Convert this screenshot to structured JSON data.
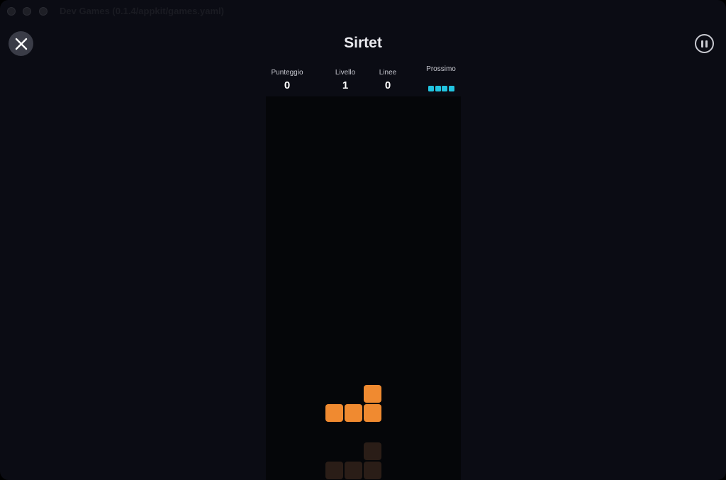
{
  "window": {
    "title": "Dev Games (0.1.4/appkit/games.yaml)"
  },
  "header": {
    "title": "Sirtet",
    "close_icon": "close-x-icon",
    "pause_icon": "pause-icon"
  },
  "stats": {
    "score_label": "Punteggio",
    "score_value": "0",
    "level_label": "Livello",
    "level_value": "1",
    "lines_label": "Linee",
    "lines_value": "0",
    "next_label": "Prossimo"
  },
  "next_piece": {
    "type": "I",
    "color": "#22c4e0"
  },
  "board": {
    "columns": 10,
    "background": "#050609",
    "active_piece": {
      "type": "L",
      "color": "#f08a30",
      "cells": [
        [
          5,
          0
        ],
        [
          3,
          1
        ],
        [
          4,
          1
        ],
        [
          5,
          1
        ]
      ]
    },
    "ghost_piece": {
      "color": "#2a1d17",
      "cells": [
        [
          5,
          0
        ],
        [
          3,
          1
        ],
        [
          4,
          1
        ],
        [
          5,
          1
        ]
      ]
    }
  },
  "colors": {
    "background": "#0b0c14",
    "text": "#ebebf0",
    "close_button_bg": "#3a3c47"
  }
}
